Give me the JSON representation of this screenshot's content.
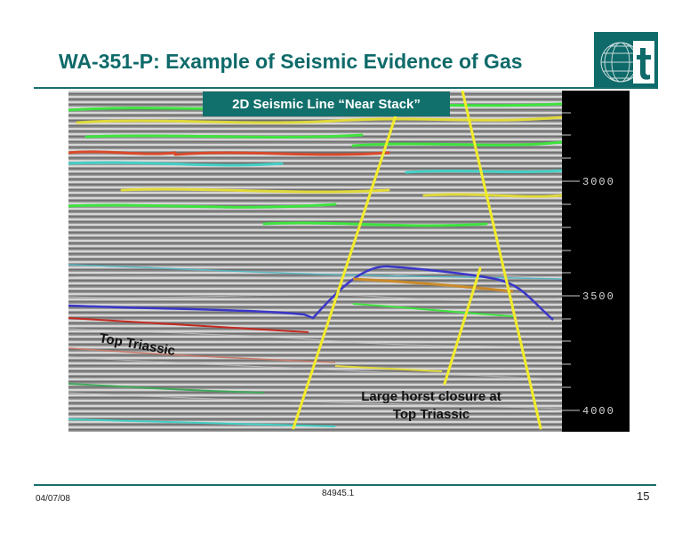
{
  "slide": {
    "title": "WA-351-P:  Example of Seismic Evidence of Gas"
  },
  "seismic": {
    "panel_label": "2D Seismic Line “Near Stack”",
    "annotation_top_triassic": "Top Triassic",
    "annotation_horst_line1": "Large horst closure at",
    "annotation_horst_line2": "Top Triassic",
    "time_scale_labels": [
      "3000",
      "3500",
      "4000"
    ]
  },
  "footer": {
    "date": "04/07/08",
    "code": "84945.1",
    "page_number": "15"
  },
  "colors": {
    "brand_teal": "#0f6a6a",
    "fault_yellow": "#f2ec2a",
    "scale_background": "#000000"
  },
  "icons": {
    "logo": "globe-with-letter-t-logo"
  }
}
